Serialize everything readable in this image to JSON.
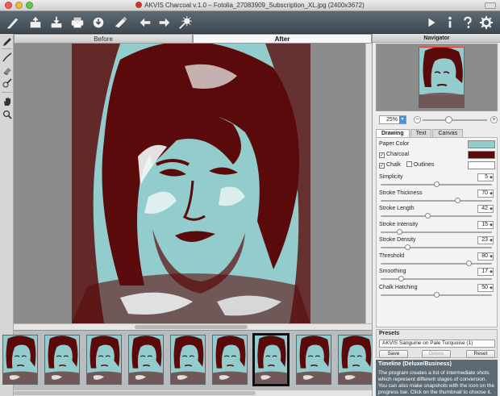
{
  "window": {
    "title": "AKVIS Charcoal v.1.0 – Fotolia_27083909_Subscription_XL.jpg (2400x3672)"
  },
  "view_tabs": {
    "before": "Before",
    "after": "After"
  },
  "navigator": {
    "title": "Navigator",
    "zoom": "25%",
    "zoom_minus": "−",
    "zoom_plus": "+"
  },
  "settings": {
    "tabs": [
      "Drawing",
      "Text",
      "Canvas"
    ],
    "paper_color_label": "Paper Color",
    "charcoal_label": "Charcoal",
    "chalk_label": "Chalk",
    "outlines_label": "Outlines",
    "colors": {
      "paper": "#93cccc",
      "charcoal": "#5a0a0a",
      "chalk": "#ffffff"
    },
    "params": [
      {
        "label": "Simplicity",
        "value": "5",
        "fraction": 0.5
      },
      {
        "label": "Stroke Thickness",
        "value": "70",
        "fraction": 0.7
      },
      {
        "label": "Stroke Length",
        "value": "42",
        "fraction": 0.42
      },
      {
        "label": "Stroke Intensity",
        "value": "15",
        "fraction": 0.15
      },
      {
        "label": "Stroke Density",
        "value": "23",
        "fraction": 0.23
      },
      {
        "label": "Threshold",
        "value": "80",
        "fraction": 0.8
      },
      {
        "label": "Smoothing",
        "value": "17",
        "fraction": 0.17
      },
      {
        "label": "Chalk Hatching",
        "value": "50",
        "fraction": 0.5
      }
    ]
  },
  "presets": {
    "title": "Presets",
    "selected": "AKVIS Sanguine on Pale Turquoise (1)",
    "save": "Save",
    "delete": "Delete",
    "reset": "Reset"
  },
  "help": {
    "title": "Timeline (Deluxe/Business)",
    "text": "The program creates a list of intermediate shots which represent different stages of conversion. You can also make snapshots with the icon on the progress bar. Click on the thumbnail to choose it."
  }
}
